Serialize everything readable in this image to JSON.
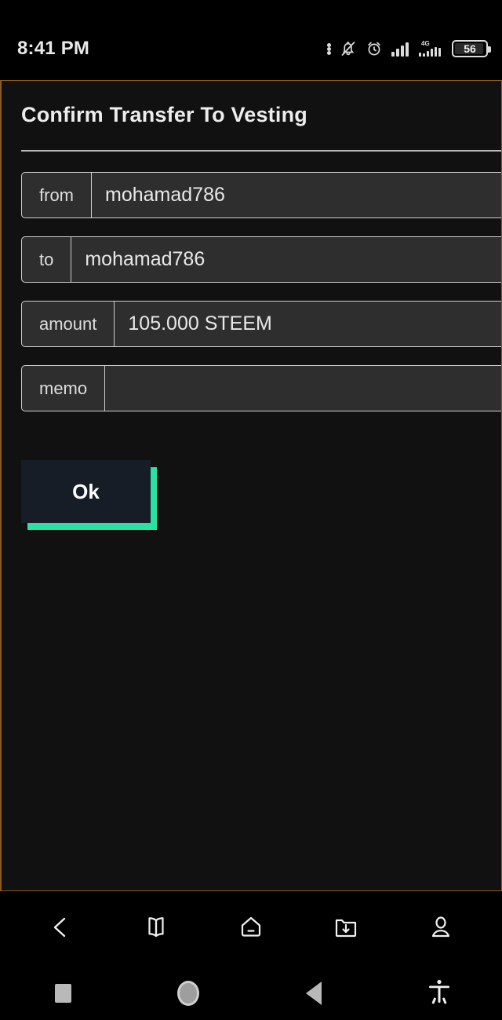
{
  "status_bar": {
    "time": "8:41 PM",
    "icons": [
      {
        "name": "more-dots-icon"
      },
      {
        "name": "bell-muted-icon"
      },
      {
        "name": "alarm-clock-icon"
      },
      {
        "name": "signal-bars-icon"
      },
      {
        "name": "signal-4g-icon",
        "label": "4G"
      },
      {
        "name": "battery-icon"
      }
    ],
    "battery_level": "56"
  },
  "page": {
    "title": "Confirm Transfer To Vesting"
  },
  "form": {
    "rows": [
      {
        "name": "from",
        "label": "from",
        "value": "mohamad786"
      },
      {
        "name": "to",
        "label": "to",
        "value": "mohamad786"
      },
      {
        "name": "amount",
        "label": "amount",
        "value": "105.000 STEEM"
      },
      {
        "name": "memo",
        "label": "memo",
        "value": ""
      }
    ]
  },
  "actions": {
    "ok_label": "Ok",
    "ok_shadow_color": "#27e2a4",
    "ok_face_color": "#161d26"
  },
  "app_nav": {
    "items": [
      {
        "name": "back-chevron-icon",
        "label": "Back"
      },
      {
        "name": "book-icon",
        "label": "Book"
      },
      {
        "name": "home-icon",
        "label": "Home"
      },
      {
        "name": "folder-download-icon",
        "label": "Downloads"
      },
      {
        "name": "profile-icon",
        "label": "Profile"
      }
    ]
  },
  "system_nav": {
    "items": [
      {
        "name": "recents-square-icon",
        "label": "Recents"
      },
      {
        "name": "home-circle-icon",
        "label": "Home"
      },
      {
        "name": "back-triangle-icon",
        "label": "Back"
      },
      {
        "name": "accessibility-icon",
        "label": "Accessibility"
      }
    ]
  },
  "colors": {
    "page_background": "#111111",
    "row_background": "#2e2e2e",
    "row_border": "#cfcfcf",
    "frame_border": "#8a5a20",
    "accent": "#27e2a4"
  }
}
